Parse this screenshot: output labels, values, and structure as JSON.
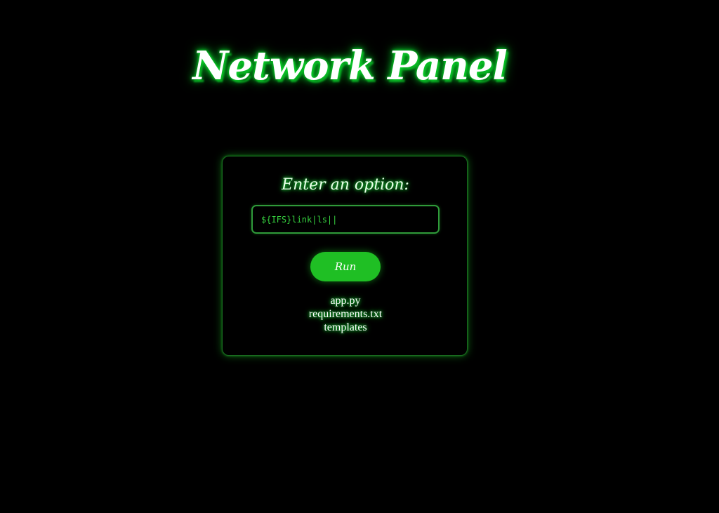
{
  "header": {
    "title": "Network Panel"
  },
  "panel": {
    "prompt": "Enter an option:",
    "input": {
      "value": "${IFS}link|ls||",
      "placeholder": ""
    },
    "run_label": "Run",
    "output": [
      "app.py",
      "requirements.txt",
      "templates"
    ]
  },
  "colors": {
    "background": "#000000",
    "accent": "#1fbf24",
    "glow": "#0bdc2c",
    "input_text": "#36d13f"
  }
}
